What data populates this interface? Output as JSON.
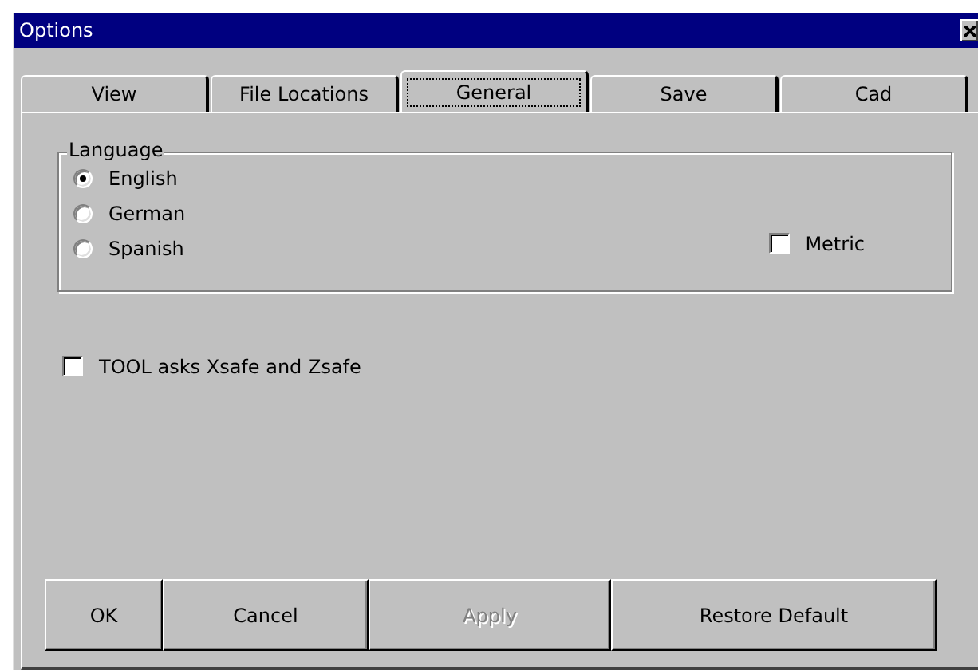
{
  "window": {
    "title": "Options"
  },
  "tabs": [
    {
      "label": "View",
      "selected": false
    },
    {
      "label": "File Locations",
      "selected": false
    },
    {
      "label": "General",
      "selected": true
    },
    {
      "label": "Save",
      "selected": false
    },
    {
      "label": "Cad",
      "selected": false
    }
  ],
  "language_group": {
    "title": "Language",
    "options": [
      {
        "label": "English",
        "selected": true
      },
      {
        "label": "German",
        "selected": false
      },
      {
        "label": "Spanish",
        "selected": false
      }
    ],
    "metric": {
      "label": "Metric",
      "checked": false
    }
  },
  "tool_safe": {
    "label": "TOOL asks Xsafe and Zsafe",
    "checked": false
  },
  "buttons": [
    {
      "label": "OK",
      "disabled": false
    },
    {
      "label": "Cancel",
      "disabled": false
    },
    {
      "label": "Apply",
      "disabled": true
    },
    {
      "label": "Restore Default",
      "disabled": false
    }
  ]
}
